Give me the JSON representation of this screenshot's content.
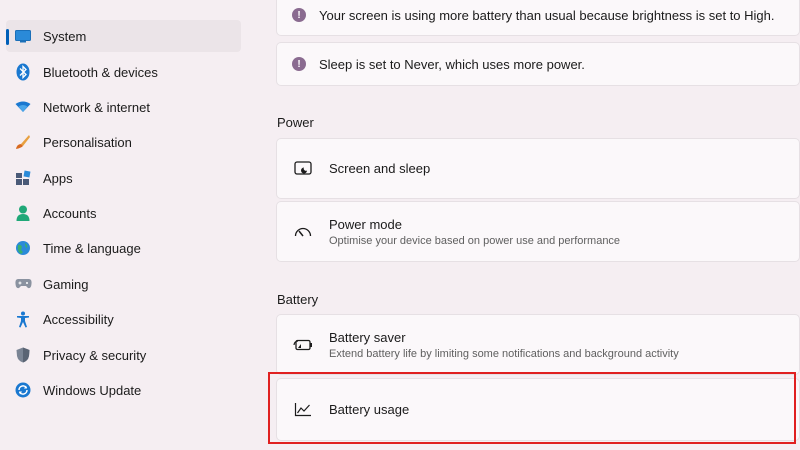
{
  "sidebar": {
    "items": [
      {
        "label": "System",
        "icon": "monitor-icon",
        "selected": true
      },
      {
        "label": "Bluetooth & devices",
        "icon": "bluetooth-icon"
      },
      {
        "label": "Network & internet",
        "icon": "wifi-icon"
      },
      {
        "label": "Personalisation",
        "icon": "brush-icon"
      },
      {
        "label": "Apps",
        "icon": "apps-icon"
      },
      {
        "label": "Accounts",
        "icon": "person-icon"
      },
      {
        "label": "Time & language",
        "icon": "globe-icon"
      },
      {
        "label": "Gaming",
        "icon": "gamepad-icon"
      },
      {
        "label": "Accessibility",
        "icon": "accessibility-icon"
      },
      {
        "label": "Privacy & security",
        "icon": "shield-icon"
      },
      {
        "label": "Windows Update",
        "icon": "update-icon"
      }
    ]
  },
  "notices": [
    {
      "text": "Your screen is using more battery than usual because brightness is set to High.",
      "icon": "info-icon"
    },
    {
      "text": "Sleep is set to Never, which uses more power.",
      "icon": "info-icon"
    }
  ],
  "power": {
    "section_title": "Power",
    "items": [
      {
        "title": "Screen and sleep",
        "subtitle": "",
        "icon": "screen-sleep-icon"
      },
      {
        "title": "Power mode",
        "subtitle": "Optimise your device based on power use and performance",
        "icon": "gauge-icon"
      }
    ]
  },
  "battery": {
    "section_title": "Battery",
    "items": [
      {
        "title": "Battery saver",
        "subtitle": "Extend battery life by limiting some notifications and background activity",
        "icon": "battery-saver-icon"
      },
      {
        "title": "Battery usage",
        "subtitle": "",
        "icon": "chart-line-icon"
      }
    ]
  },
  "colors": {
    "accent": "#005fb8",
    "highlight": "#e02020",
    "background": "#f5eef2",
    "card": "#fbf8fa"
  }
}
